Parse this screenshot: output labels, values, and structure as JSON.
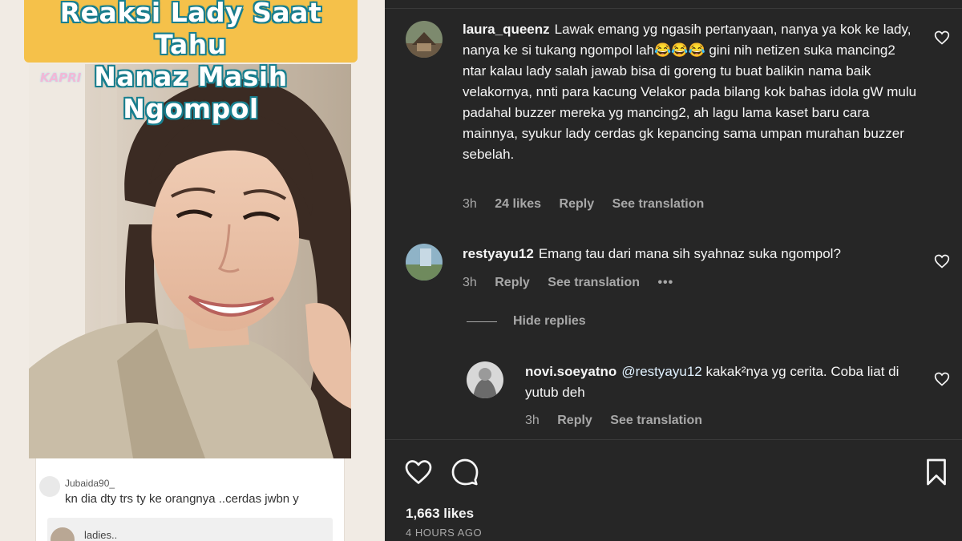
{
  "post_media": {
    "title_line1": "Reaksi Lady Saat Tahu",
    "title_line2": "Nanaz Masih Ngompol",
    "photo_logo": "KAPRI",
    "embedded_comment": {
      "username": "Jubaida90_",
      "text": "kn dia dty trs ty ke orangnya ..cerdas jwbn y"
    },
    "embedded_reply_username": "ladies.."
  },
  "comments": [
    {
      "username": "laura_queenz",
      "text": "Lawak emang yg ngasih pertanyaan, nanya ya kok ke lady, nanya ke si tukang ngompol lah😂😂😂 gini nih netizen suka mancing2 ntar kalau lady salah jawab bisa di goreng tu buat balikin nama baik velakornya, nnti para kacung Velakor pada bilang kok bahas idola gW mulu padahal buzzer mereka yg mancing2, ah lagu lama kaset baru cara mainnya, syukur lady cerdas gk kepancing sama umpan murahan buzzer sebelah.",
      "time": "3h",
      "likes": "24 likes",
      "reply": "Reply",
      "translate": "See translation"
    },
    {
      "username": "restyayu12",
      "text": "Emang tau dari mana sih syahnaz suka ngompol?",
      "time": "3h",
      "reply": "Reply",
      "translate": "See translation",
      "more": "•••"
    }
  ],
  "hide_replies": "Hide replies",
  "reply": {
    "username": "novi.soeyatno",
    "mention": "@restyayu12",
    "text": "kakak²nya yg cerita. Coba liat di yutub deh",
    "time": "3h",
    "reply": "Reply",
    "translate": "See translation"
  },
  "footer": {
    "likes": "1,663 likes",
    "time_ago": "4 HOURS AGO"
  },
  "icons": [
    "heart-icon",
    "comment-icon",
    "bookmark-icon",
    "like-comment-icon"
  ],
  "colors": {
    "panel_bg": "#262626",
    "banner": "#f5c14a",
    "secondary_text": "#a8a8a8"
  }
}
